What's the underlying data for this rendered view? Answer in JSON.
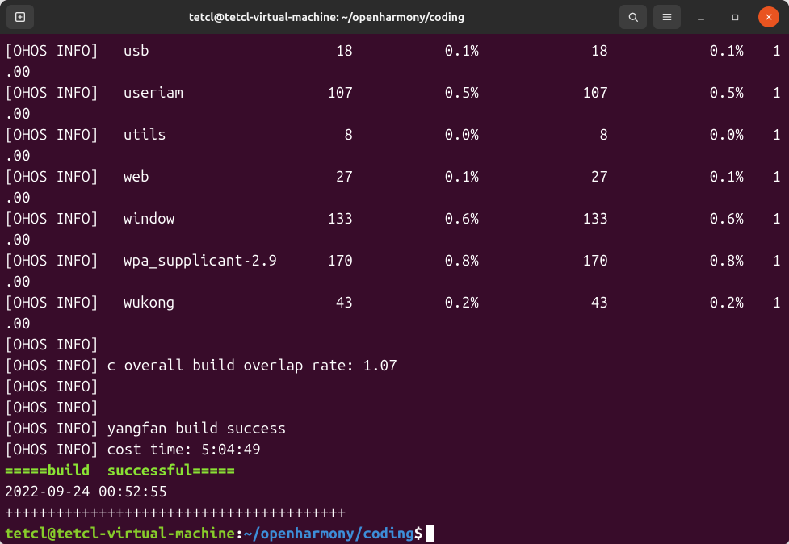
{
  "window": {
    "title": "tetcl@tetcl-virtual-machine: ~/openharmony/coding"
  },
  "log_prefix": "[OHOS INFO]",
  "trailing": ".00",
  "rows": [
    {
      "name": "usb",
      "n1": "18",
      "p1": "0.1%",
      "n2": "18",
      "p2": "0.1%",
      "x": "1"
    },
    {
      "name": "useriam",
      "n1": "107",
      "p1": "0.5%",
      "n2": "107",
      "p2": "0.5%",
      "x": "1"
    },
    {
      "name": "utils",
      "n1": "8",
      "p1": "0.0%",
      "n2": "8",
      "p2": "0.0%",
      "x": "1"
    },
    {
      "name": "web",
      "n1": "27",
      "p1": "0.1%",
      "n2": "27",
      "p2": "0.1%",
      "x": "1"
    },
    {
      "name": "window",
      "n1": "133",
      "p1": "0.6%",
      "n2": "133",
      "p2": "0.6%",
      "x": "1"
    },
    {
      "name": "wpa_supplicant-2.9",
      "n1": "170",
      "p1": "0.8%",
      "n2": "170",
      "p2": "0.8%",
      "x": "1"
    },
    {
      "name": "wukong",
      "n1": "43",
      "p1": "0.2%",
      "n2": "43",
      "p2": "0.2%",
      "x": "1"
    }
  ],
  "tail_lines": [
    "[OHOS INFO]",
    "[OHOS INFO] c overall build overlap rate: 1.07",
    "[OHOS INFO]",
    "[OHOS INFO]",
    "[OHOS INFO] yangfan build success",
    "[OHOS INFO] cost time: 5:04:49"
  ],
  "success_line": "=====build  successful=====",
  "timestamp": "2022-09-24 00:52:55",
  "plus_line": "++++++++++++++++++++++++++++++++++++++++",
  "prompt": {
    "user": "tetcl@tetcl-virtual-machine",
    "sep": ":",
    "path": "~/openharmony/coding",
    "sym": "$"
  }
}
